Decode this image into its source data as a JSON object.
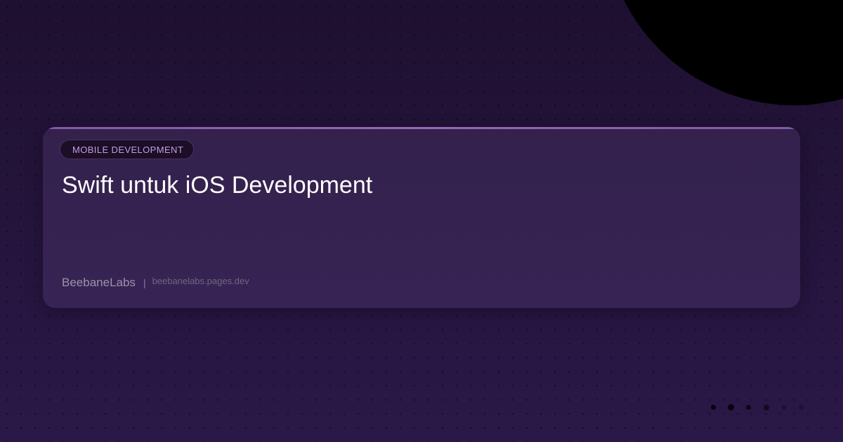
{
  "card": {
    "category": "MOBILE DEVELOPMENT",
    "title": "Swift untuk iOS Development",
    "brand": "BeebaneLabs",
    "separator": "|",
    "url": "beebanelabs.pages.dev"
  },
  "colors": {
    "background": "#23123a",
    "accent": "#9c72c4",
    "category_text": "#c79be6",
    "title_text": "#ffffff"
  }
}
